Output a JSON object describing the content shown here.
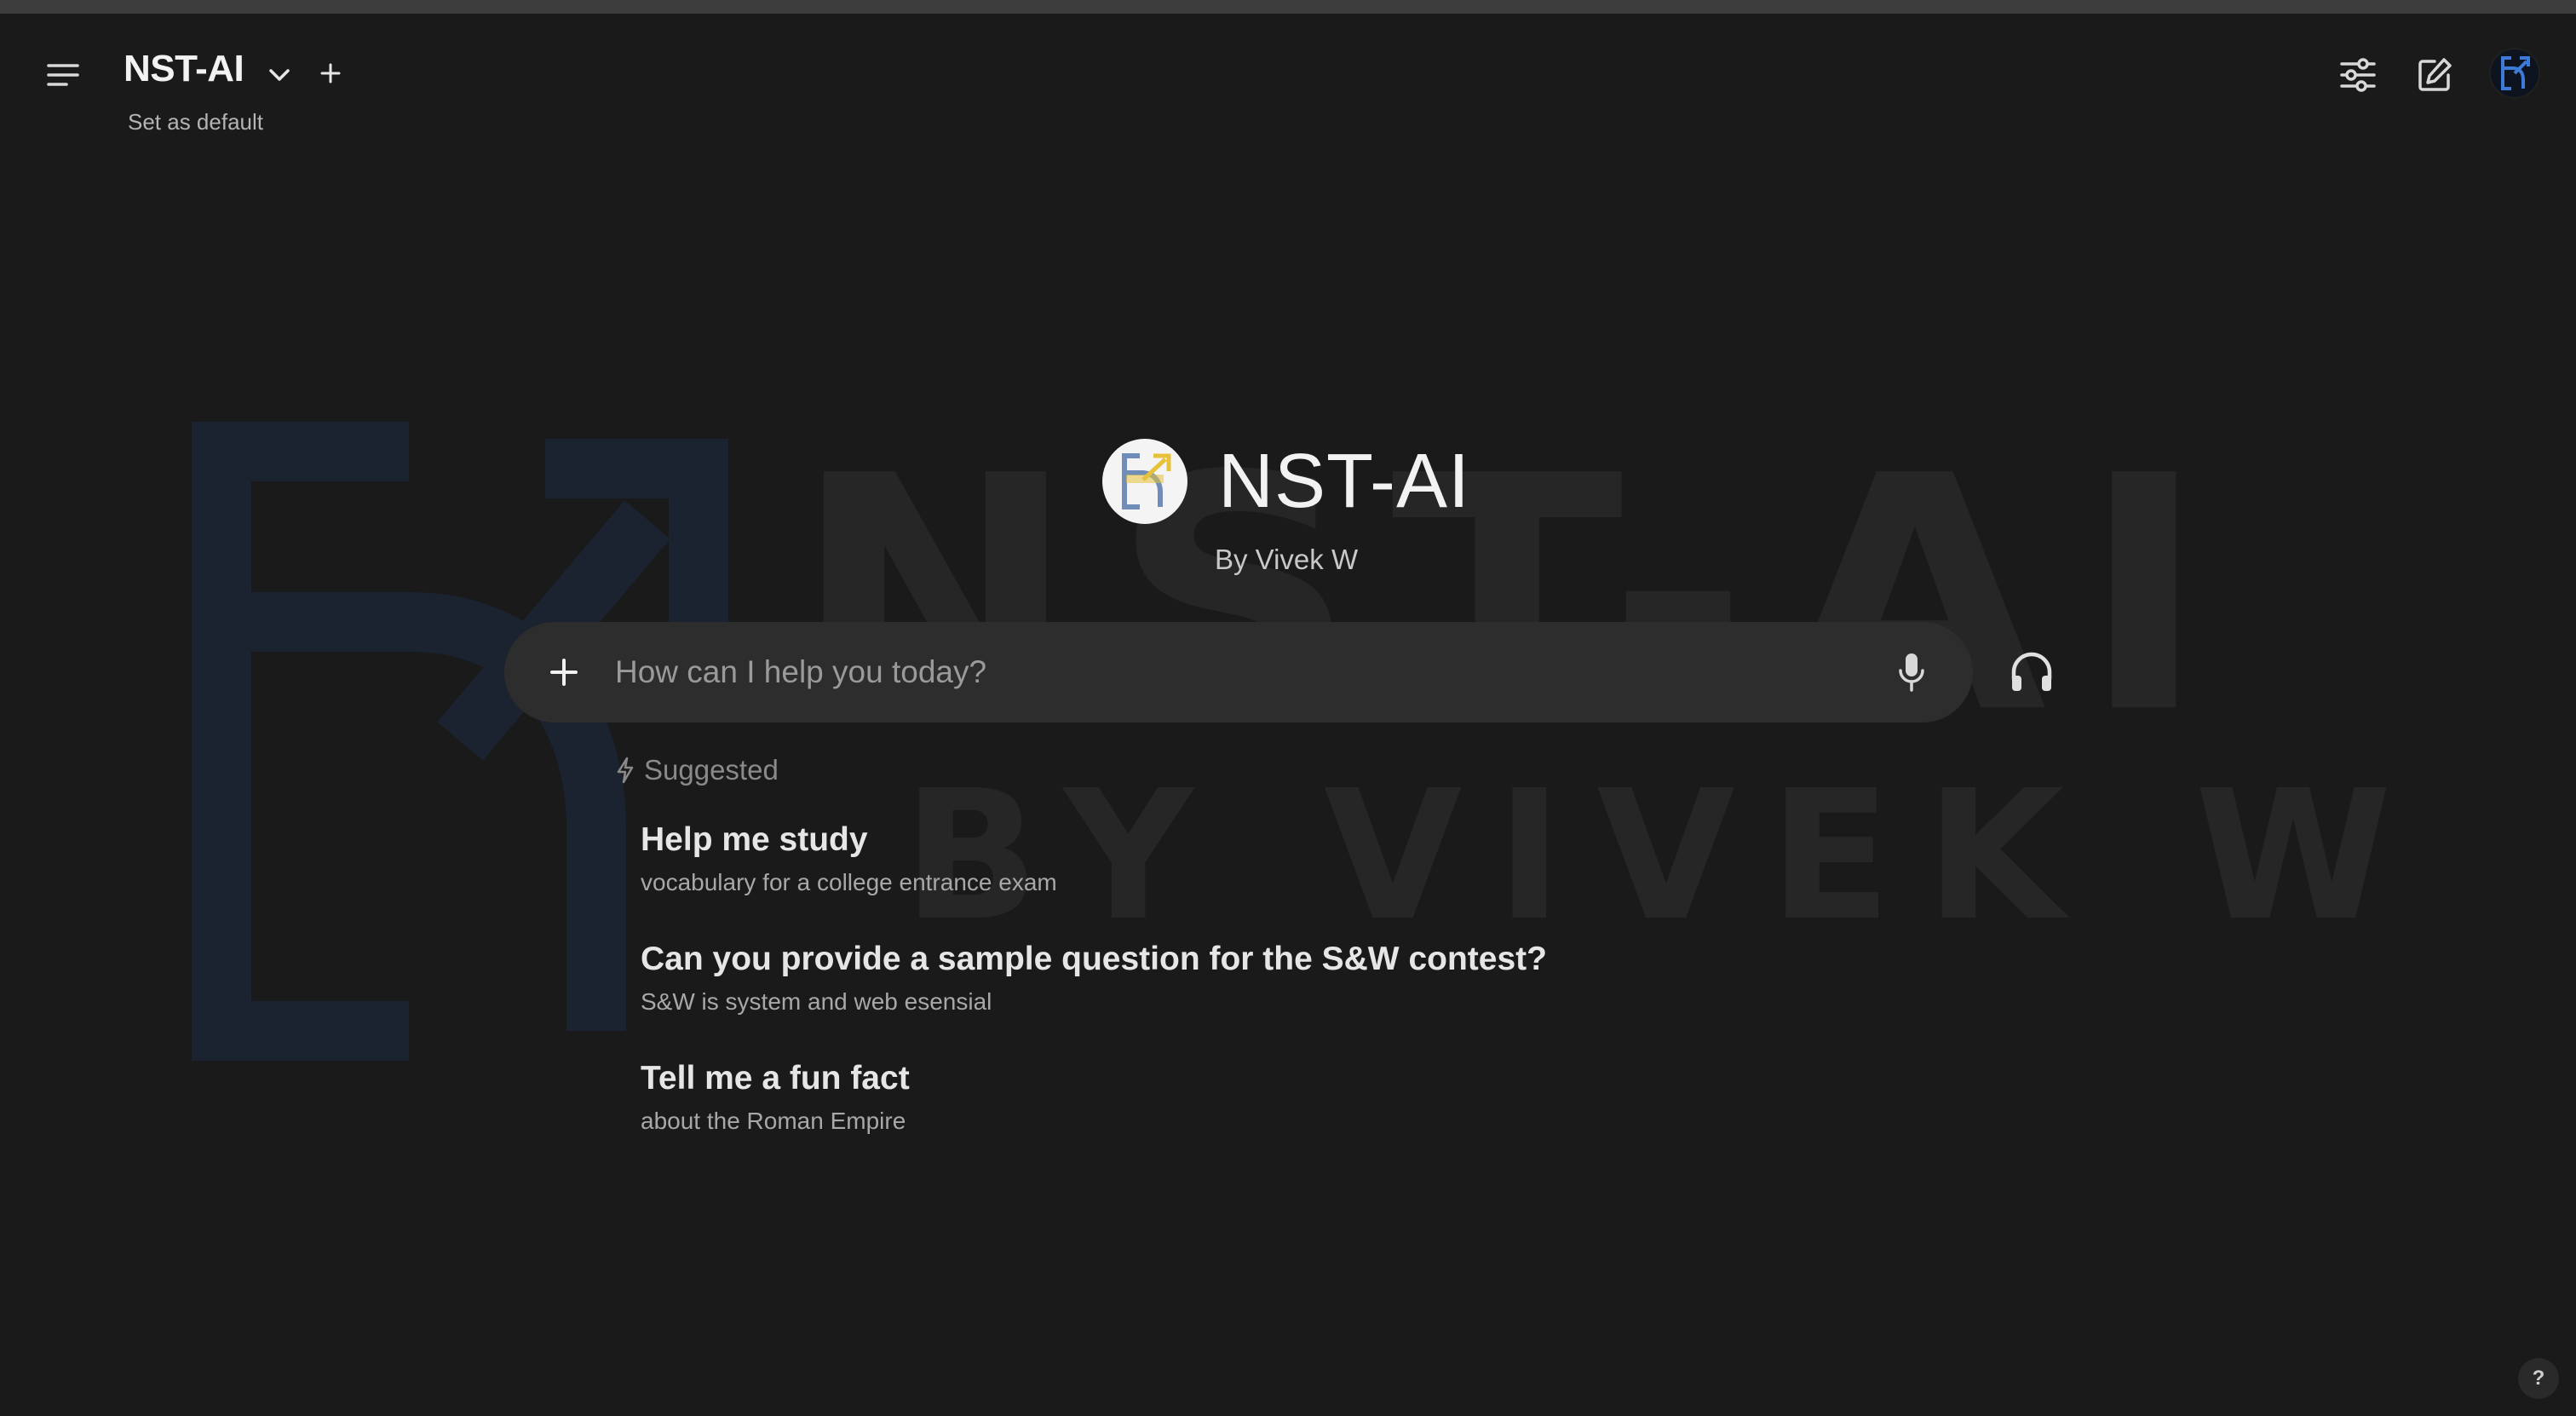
{
  "header": {
    "model_name": "NST-AI",
    "set_default_label": "Set as default"
  },
  "hero": {
    "title": "NST-AI",
    "byline": "By Vivek W"
  },
  "watermark": {
    "line1": "NST-AI",
    "line2": "BY VIVEK W"
  },
  "composer": {
    "placeholder": "How can I help you today?"
  },
  "suggested": {
    "label": "Suggested",
    "items": [
      {
        "title": "Help me study",
        "subtitle": "vocabulary for a college entrance exam"
      },
      {
        "title": "Can you provide a sample question for the S&W contest?",
        "subtitle": "S&W is system and web esensial"
      },
      {
        "title": "Tell me a fun fact",
        "subtitle": "about the Roman Empire"
      }
    ]
  },
  "help_label": "?",
  "colors": {
    "background": "#1a1a1a",
    "composer_bg": "#2d2d2d",
    "logo_blue": "#3d7bd8",
    "logo_yellow": "#e6c23a"
  },
  "icons": {
    "menu": "sidebar-menu-icon",
    "chevron": "chevron-down-icon",
    "plus": "plus-icon",
    "controls": "sliders-icon",
    "new_chat": "edit-icon",
    "mic": "microphone-icon",
    "voice": "headphones-icon",
    "suggested": "lightning-icon"
  }
}
